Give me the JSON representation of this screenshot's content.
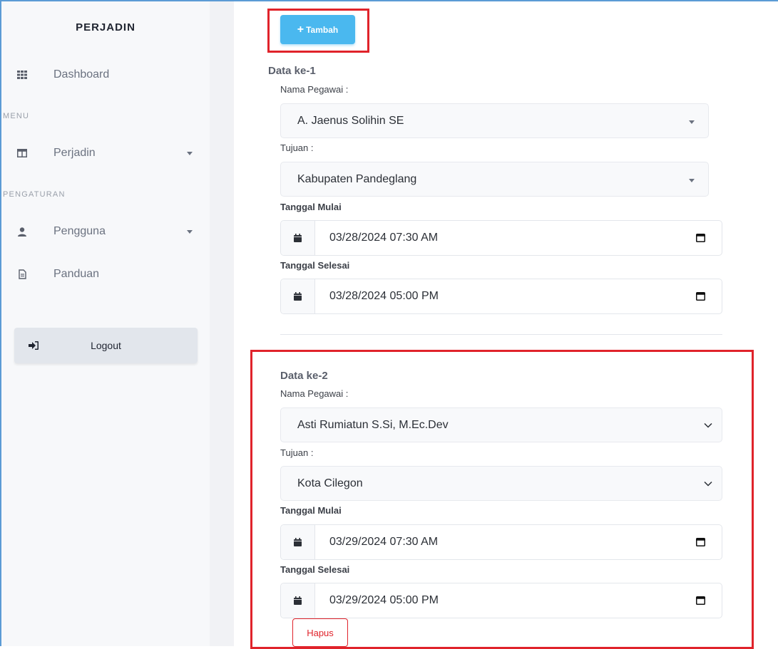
{
  "sidebar": {
    "brand": "PERJADIN",
    "dashboard": {
      "label": "Dashboard",
      "icon": "grid-icon"
    },
    "section_menu": "MENU",
    "perjadin": {
      "label": "Perjadin",
      "icon": "columns-icon"
    },
    "section_settings": "PENGATURAN",
    "pengguna": {
      "label": "Pengguna",
      "icon": "user-icon"
    },
    "panduan": {
      "label": "Panduan",
      "icon": "document-icon"
    },
    "logout": {
      "label": "Logout",
      "icon": "sign-out-icon"
    }
  },
  "toolbar": {
    "add_label": "Tambah"
  },
  "entries": [
    {
      "title": "Data ke-1",
      "employee_label": "Nama Pegawai :",
      "employee_value": "A. Jaenus Solihin SE",
      "destination_label": "Tujuan :",
      "destination_value": "Kabupaten Pandeglang",
      "start_label": "Tanggal Mulai",
      "start_value": "03/28/2024 07:30 AM",
      "end_label": "Tanggal Selesai",
      "end_value": "03/28/2024 05:00 PM"
    },
    {
      "title": "Data ke-2",
      "employee_label": "Nama Pegawai :",
      "employee_value": "Asti Rumiatun S.Si, M.Ec.Dev",
      "destination_label": "Tujuan :",
      "destination_value": "Kota Cilegon",
      "start_label": "Tanggal Mulai",
      "start_value": "03/29/2024 07:30 AM",
      "end_label": "Tanggal Selesai",
      "end_value": "03/29/2024 05:00 PM",
      "delete_label": "Hapus"
    }
  ],
  "colors": {
    "accent": "#4ab8ef",
    "highlight": "#e0232b",
    "frame": "#5b9bd5"
  }
}
